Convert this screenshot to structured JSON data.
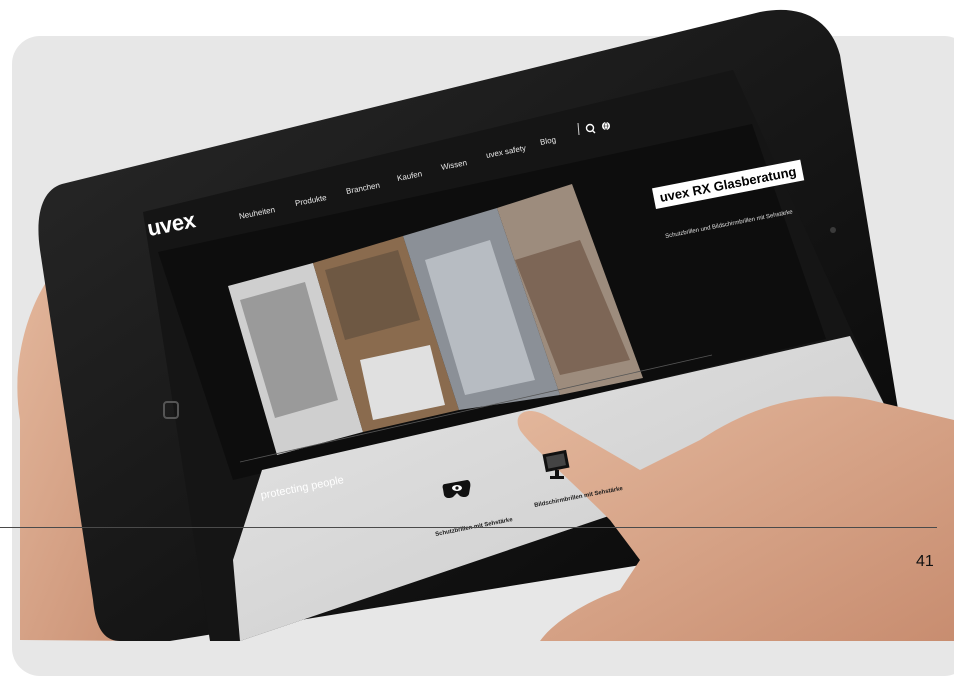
{
  "brand": {
    "logo_text": "uvex"
  },
  "nav": {
    "items": [
      "Neuheiten",
      "Produkte",
      "Branchen",
      "Kaufen",
      "Wissen",
      "uvex safety",
      "Blog"
    ]
  },
  "hero": {
    "title": "uvex RX Glasberatung",
    "subtitle": "Schutzbrillen und Bildschirmbrillen mit Sehstärke"
  },
  "tagline": "protecting people",
  "categories": [
    {
      "label": "Schutzbrillen mit Sehstärke",
      "icon": "goggles-icon"
    },
    {
      "label": "Bildschirmbrillen mit Sehstärke",
      "icon": "monitor-icon"
    }
  ],
  "page": {
    "number": "41"
  },
  "colors": {
    "backdrop": "#e7e7e7",
    "tablet_frame": "#111111",
    "screen_bg": "#141414",
    "skin": "#d9a98c",
    "light_panel": "#d6d6d6"
  }
}
